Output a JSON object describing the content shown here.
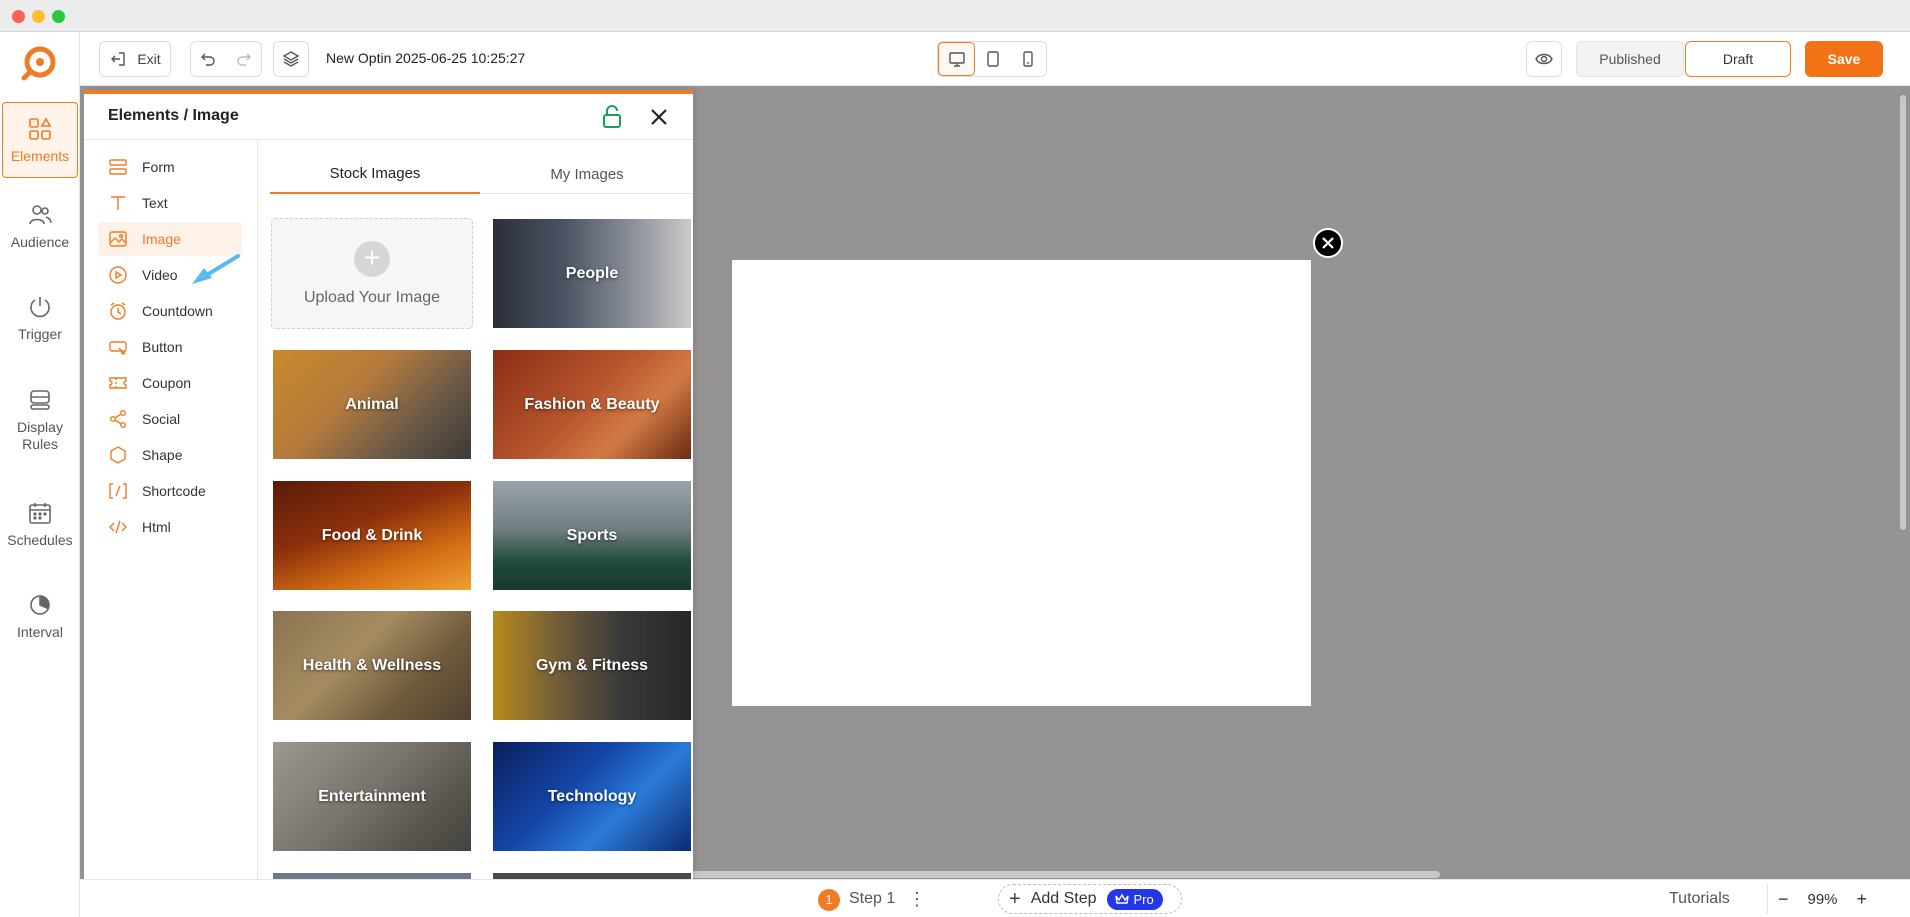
{
  "toolbar": {
    "exit_label": "Exit",
    "doc_title": "New Optin 2025-06-25 10:25:27",
    "published_label": "Published",
    "draft_label": "Draft",
    "save_label": "Save"
  },
  "rail": {
    "items": [
      {
        "label": "Elements",
        "icon": "elements-icon",
        "active": true
      },
      {
        "label": "Audience",
        "icon": "audience-icon"
      },
      {
        "label": "Trigger",
        "icon": "power-icon"
      },
      {
        "label": "Display Rules",
        "icon": "display-rules-icon"
      },
      {
        "label": "Schedules",
        "icon": "calendar-icon"
      },
      {
        "label": "Interval",
        "icon": "interval-icon"
      }
    ]
  },
  "panel": {
    "title": "Elements / Image",
    "nav": [
      {
        "label": "Form",
        "icon": "form-icon"
      },
      {
        "label": "Text",
        "icon": "text-icon"
      },
      {
        "label": "Image",
        "icon": "image-icon",
        "active": true
      },
      {
        "label": "Video",
        "icon": "video-icon"
      },
      {
        "label": "Countdown",
        "icon": "countdown-icon"
      },
      {
        "label": "Button",
        "icon": "button-icon"
      },
      {
        "label": "Coupon",
        "icon": "coupon-icon"
      },
      {
        "label": "Social",
        "icon": "share-icon"
      },
      {
        "label": "Shape",
        "icon": "hexagon-icon"
      },
      {
        "label": "Shortcode",
        "icon": "shortcode-icon"
      },
      {
        "label": "Html",
        "icon": "code-icon"
      }
    ],
    "tabs": [
      {
        "label": "Stock Images",
        "active": true
      },
      {
        "label": "My Images"
      }
    ],
    "upload_label": "Upload Your Image",
    "categories": [
      {
        "label": "People"
      },
      {
        "label": "Animal"
      },
      {
        "label": "Fashion & Beauty"
      },
      {
        "label": "Food & Drink"
      },
      {
        "label": "Sports"
      },
      {
        "label": "Health & Wellness"
      },
      {
        "label": "Gym & Fitness"
      },
      {
        "label": "Entertainment"
      },
      {
        "label": "Technology"
      }
    ]
  },
  "bottombar": {
    "step_number": "1",
    "step_label": "Step 1",
    "add_step_label": "Add Step",
    "pro_label": "Pro",
    "tutorials_label": "Tutorials",
    "zoom_value": "99%"
  },
  "colors": {
    "accent": "#f07b23",
    "save": "#f47216",
    "pro": "#2437e6",
    "canvas": "#959393"
  }
}
